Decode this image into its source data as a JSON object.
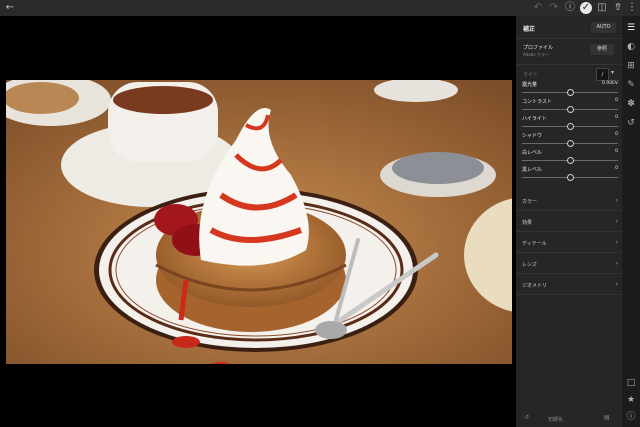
{
  "icons": {
    "back": "back-arrow-icon",
    "undo": "undo-icon",
    "redo": "redo-icon",
    "help": "help-icon",
    "done": "checkmark-icon",
    "compare": "compare-icon",
    "share": "share-icon",
    "more": "more-vertical-icon"
  },
  "panel": {
    "title": "補正",
    "auto_label": "AUTO",
    "profile": {
      "label": "プロファイル",
      "value": "Adobe カラー",
      "browse_label": "参照"
    },
    "light_label": "ライト",
    "sliders": [
      {
        "label": "露光量",
        "value": "0.00EV",
        "position": 0.5
      },
      {
        "label": "コントラスト",
        "value": "0",
        "position": 0.5
      },
      {
        "label": "ハイライト",
        "value": "0",
        "position": 0.5
      },
      {
        "label": "シャドウ",
        "value": "0",
        "position": 0.5
      },
      {
        "label": "白レベル",
        "value": "0",
        "position": 0.5
      },
      {
        "label": "黒レベル",
        "value": "0",
        "position": 0.5
      }
    ],
    "sections": [
      "カラー",
      "効果",
      "ディテール",
      "レンズ",
      "ジオメトリ"
    ],
    "footer": {
      "reset_label": "初期化"
    }
  },
  "colors": {
    "panel_bg": "#262626",
    "canvas_bg": "#000000",
    "accent": "#ffffff"
  }
}
